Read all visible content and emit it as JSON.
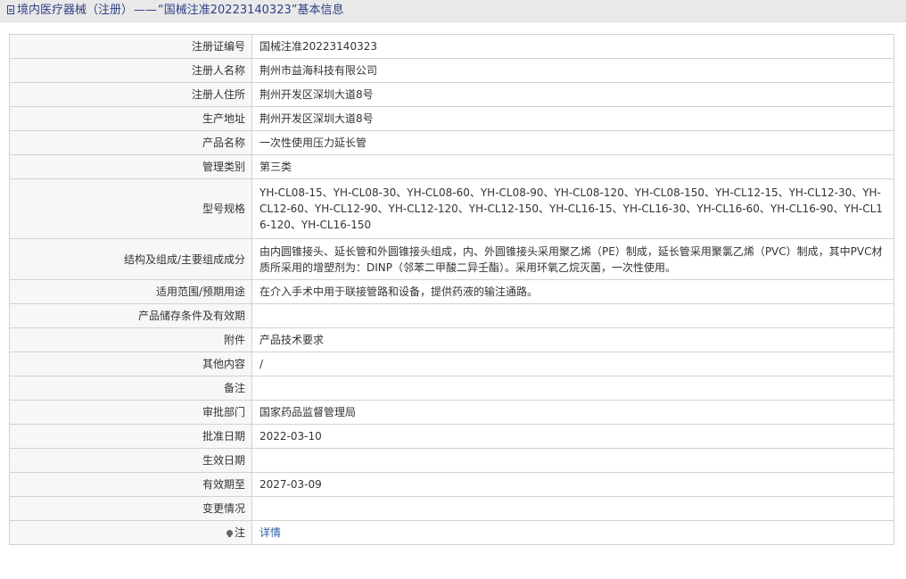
{
  "header": {
    "section": "境内医疗器械（注册）",
    "separator": "——",
    "record_title": "“国械注准20223140323”基本信息"
  },
  "rows": [
    {
      "label": "注册证编号",
      "value": "国械注准20223140323"
    },
    {
      "label": "注册人名称",
      "value": "荆州市益海科技有限公司"
    },
    {
      "label": "注册人住所",
      "value": "荆州开发区深圳大道8号"
    },
    {
      "label": "生产地址",
      "value": "荆州开发区深圳大道8号"
    },
    {
      "label": "产品名称",
      "value": "一次性使用压力延长管"
    },
    {
      "label": "管理类别",
      "value": "第三类"
    },
    {
      "label": "型号规格",
      "value": "YH-CL08-15、YH-CL08-30、YH-CL08-60、YH-CL08-90、YH-CL08-120、YH-CL08-150、YH-CL12-15、YH-CL12-30、YH-CL12-60、YH-CL12-90、YH-CL12-120、YH-CL12-150、YH-CL16-15、YH-CL16-30、YH-CL16-60、YH-CL16-90、YH-CL16-120、YH-CL16-150"
    },
    {
      "label": "结构及组成/主要组成成分",
      "value": "由内圆锥接头、延长管和外圆锥接头组成，内、外圆锥接头采用聚乙烯（PE）制成，延长管采用聚氯乙烯（PVC）制成，其中PVC材质所采用的增塑剂为：DINP（邻苯二甲酸二异壬酯）。采用环氧乙烷灭菌，一次性使用。"
    },
    {
      "label": "适用范围/预期用途",
      "value": "在介入手术中用于联接管路和设备，提供药液的输注通路。"
    },
    {
      "label": "产品储存条件及有效期",
      "value": ""
    },
    {
      "label": "附件",
      "value": "产品技术要求"
    },
    {
      "label": "其他内容",
      "value": "/"
    },
    {
      "label": "备注",
      "value": ""
    },
    {
      "label": "审批部门",
      "value": "国家药品监督管理局"
    },
    {
      "label": "批准日期",
      "value": "2022-03-10"
    },
    {
      "label": "生效日期",
      "value": ""
    },
    {
      "label": "有效期至",
      "value": "2027-03-09"
    },
    {
      "label": "变更情况",
      "value": ""
    }
  ],
  "note": {
    "icon": "bulb-icon",
    "label": "注",
    "link_text": "详情",
    "link_color": "#2f5fa8"
  },
  "colors": {
    "title_text": "#2f3f85",
    "title_bar_bg": "#e9e9e9",
    "label_cell_bg": "#f7f7f7",
    "border": "#d2d2d2"
  }
}
